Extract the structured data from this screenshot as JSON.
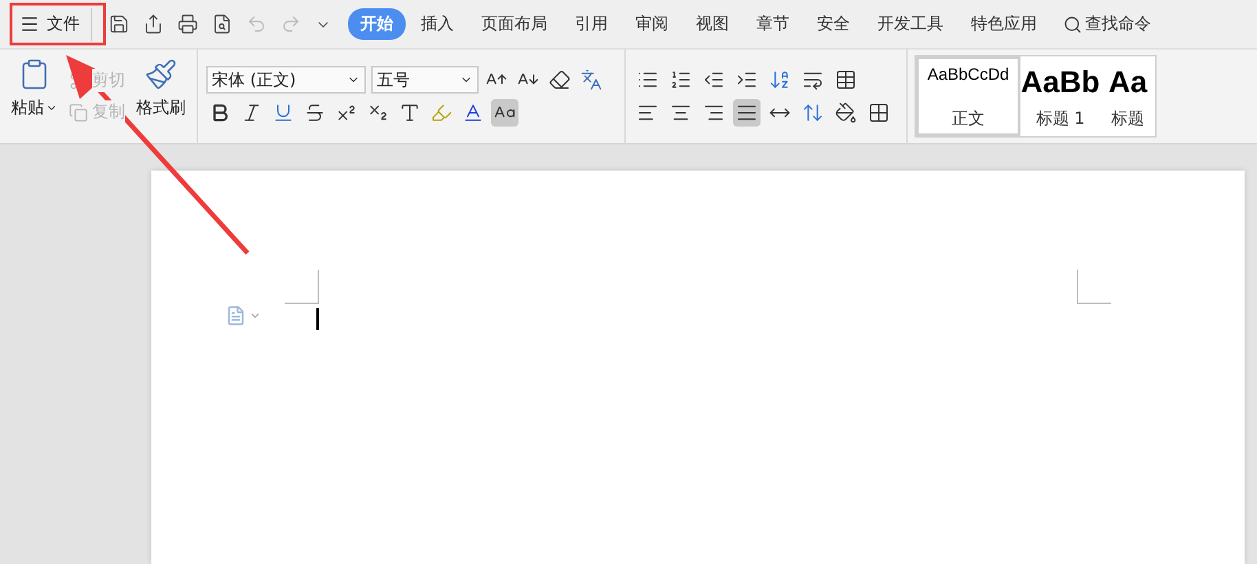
{
  "menu": {
    "file": "文件",
    "quick_access": [
      {
        "kind": "save",
        "disabled": false
      },
      {
        "kind": "export",
        "disabled": false
      },
      {
        "kind": "print",
        "disabled": false
      },
      {
        "kind": "preview",
        "disabled": false
      },
      {
        "kind": "undo",
        "disabled": true
      },
      {
        "kind": "redo",
        "disabled": true
      },
      {
        "kind": "more",
        "disabled": false
      }
    ],
    "tabs": [
      {
        "label": "开始",
        "selected": true
      },
      {
        "label": "插入",
        "selected": false
      },
      {
        "label": "页面布局",
        "selected": false
      },
      {
        "label": "引用",
        "selected": false
      },
      {
        "label": "审阅",
        "selected": false
      },
      {
        "label": "视图",
        "selected": false
      },
      {
        "label": "章节",
        "selected": false
      },
      {
        "label": "安全",
        "selected": false
      },
      {
        "label": "开发工具",
        "selected": false
      },
      {
        "label": "特色应用",
        "selected": false
      }
    ],
    "search": "查找命令"
  },
  "clipboard": {
    "paste": "粘贴",
    "format_painter": "格式刷",
    "items": [
      {
        "label": "剪切",
        "disabled": true
      },
      {
        "label": "复制",
        "disabled": true
      }
    ]
  },
  "font": {
    "name": "宋体 (正文)",
    "size": "五号"
  },
  "alignment": [
    {
      "kind": "left",
      "selected": false
    },
    {
      "kind": "center",
      "selected": false
    },
    {
      "kind": "right",
      "selected": false
    },
    {
      "kind": "justify",
      "selected": true
    },
    {
      "kind": "distributed",
      "selected": false
    }
  ],
  "styles": [
    {
      "preview": "AaBbCcDd",
      "label": "正文",
      "selected": true
    },
    {
      "preview": "AaBb",
      "label": "标题 1",
      "selected": false
    },
    {
      "preview": "Aa",
      "label": "标题",
      "selected": false
    }
  ]
}
